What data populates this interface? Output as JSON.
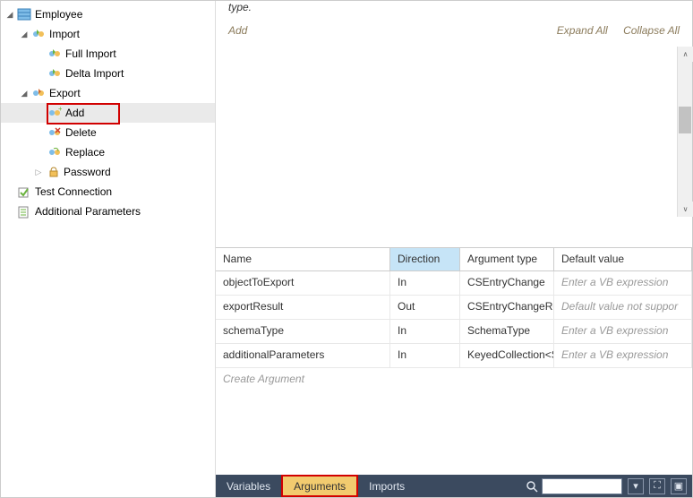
{
  "tree": {
    "root": "Employee",
    "importNode": "Import",
    "fullImport": "Full Import",
    "deltaImport": "Delta Import",
    "exportNode": "Export",
    "add": "Add",
    "delete": "Delete",
    "replace": "Replace",
    "password": "Password",
    "testConnection": "Test Connection",
    "additionalParams": "Additional Parameters"
  },
  "topBar": {
    "typeText": "type.",
    "addLink": "Add",
    "expandAll": "Expand All",
    "collapseAll": "Collapse All"
  },
  "grid": {
    "headers": {
      "name": "Name",
      "direction": "Direction",
      "argtype": "Argument type",
      "defval": "Default value"
    },
    "rows": [
      {
        "name": "objectToExport",
        "dir": "In",
        "type": "CSEntryChange",
        "def": "Enter a VB expression",
        "defPh": true
      },
      {
        "name": "exportResult",
        "dir": "Out",
        "type": "CSEntryChangeRes",
        "def": "Default value not suppor",
        "defPh": true
      },
      {
        "name": "schemaType",
        "dir": "In",
        "type": "SchemaType",
        "def": "Enter a VB expression",
        "defPh": true
      },
      {
        "name": "additionalParameters",
        "dir": "In",
        "type": "KeyedCollection<S",
        "def": "Enter a VB expression",
        "defPh": true
      }
    ],
    "createArg": "Create Argument"
  },
  "tabs": {
    "variables": "Variables",
    "arguments": "Arguments",
    "imports": "Imports"
  }
}
